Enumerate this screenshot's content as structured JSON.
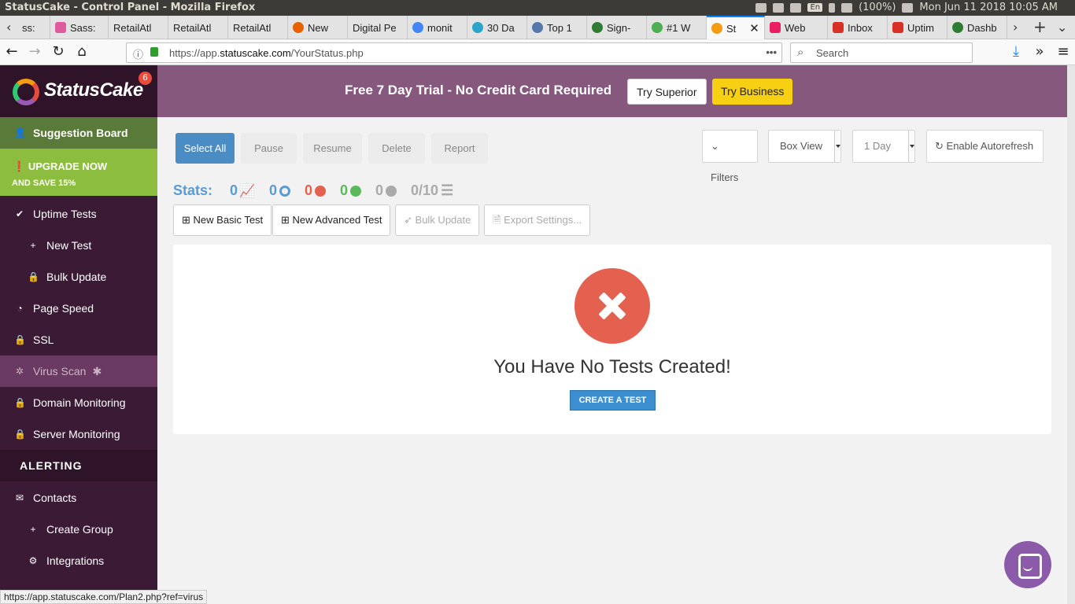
{
  "os": {
    "window_title": "StatusCake - Control Panel - Mozilla Firefox",
    "lang": "En",
    "battery": "(100%)",
    "datetime": "Mon Jun 11 2018 10:05 AM"
  },
  "tabs": [
    {
      "label": "ss:",
      "color": "#888888"
    },
    {
      "label": "Sass:",
      "color": "#e05a9e"
    },
    {
      "label": "RetailAtl",
      "color": "#cccccc"
    },
    {
      "label": "RetailAtl",
      "color": "#cccccc"
    },
    {
      "label": "RetailAtl",
      "color": "#cccccc"
    },
    {
      "label": "New",
      "color": "#e66000"
    },
    {
      "label": "Digital Pe",
      "color": "#cccccc"
    },
    {
      "label": "monit",
      "color": "#4285f4"
    },
    {
      "label": "30 Da",
      "color": "#2aa5c9"
    },
    {
      "label": "Top 1",
      "color": "#5577aa"
    },
    {
      "label": "Sign-",
      "color": "#2e7d32"
    },
    {
      "label": "#1 W",
      "color": "#4caf50"
    },
    {
      "label": "St",
      "color": "#f39c12"
    },
    {
      "label": "Web",
      "color": "#e91e63"
    },
    {
      "label": "Inbox",
      "color": "#d93025"
    },
    {
      "label": "Uptim",
      "color": "#d93025"
    },
    {
      "label": "Dashb",
      "color": "#2e7d32"
    }
  ],
  "nav": {
    "url_prefix": "https://app.",
    "url_domain": "statuscake.com",
    "url_path": "/YourStatus.php",
    "more": "•••",
    "search_placeholder": "Search"
  },
  "sidebar": {
    "brand": "StatusCake",
    "badge": "6",
    "suggestion": "Suggestion Board",
    "upgrade_l1": "UPGRADE NOW",
    "upgrade_l2": "AND SAVE 15%",
    "items": [
      {
        "label": "Uptime Tests",
        "icon": "✔"
      },
      {
        "label": "New Test",
        "icon": "+"
      },
      {
        "label": "Bulk Update",
        "icon": "🔒"
      },
      {
        "label": "Page Speed",
        "icon": "◔"
      },
      {
        "label": "SSL",
        "icon": "🔒"
      },
      {
        "label": "Virus Scan",
        "icon": "✱"
      },
      {
        "label": "Domain Monitoring",
        "icon": "🔒"
      },
      {
        "label": "Server Monitoring",
        "icon": "🔒"
      }
    ],
    "virus_star": "✱",
    "alerting": "ALERTING",
    "alert_items": [
      {
        "label": "Contacts",
        "icon": "✉"
      },
      {
        "label": "Create Group",
        "icon": "+"
      },
      {
        "label": "Integrations",
        "icon": "⚙"
      }
    ]
  },
  "status_url": "https://app.statuscake.com/Plan2.php?ref=virus",
  "banner": {
    "text": "Free 7 Day Trial - No Credit Card Required",
    "try_superior": "Try Superior",
    "try_business": "Try Business"
  },
  "toolbar": {
    "select_all": "Select All",
    "pause": "Pause",
    "resume": "Resume",
    "delete": "Delete",
    "report": "Report",
    "filters": "Filters",
    "view": "Box View",
    "period": "1 Day",
    "autorefresh": "Enable Autorefresh"
  },
  "stats": {
    "label": "Stats:",
    "total": "0",
    "paused_count": "0",
    "down": "0",
    "up": "0",
    "paused": "0",
    "quota": "0/10"
  },
  "actions": {
    "new_basic": "New Basic Test",
    "new_advanced": "New Advanced Test",
    "bulk_update": "Bulk Update",
    "export": "Export Settings..."
  },
  "empty": {
    "message": "You Have No Tests Created!",
    "create": "CREATE A TEST"
  }
}
